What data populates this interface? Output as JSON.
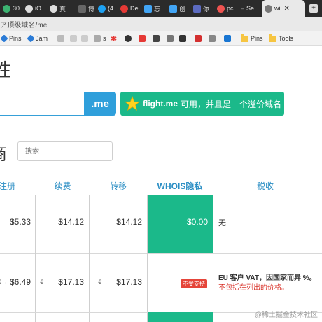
{
  "tabs": [
    {
      "label": "30",
      "icon": "green-circle-icon",
      "color": "#3cb371"
    },
    {
      "label": "iO",
      "icon": "link-icon",
      "color": "#e0e0e0"
    },
    {
      "label": "真",
      "icon": "link-icon",
      "color": "#e0e0e0"
    },
    {
      "label": "博",
      "icon": "doc-icon",
      "color": "#555"
    },
    {
      "label": "(4",
      "icon": "twitter-icon",
      "color": "#1da1f2"
    },
    {
      "label": "De",
      "icon": "star-red-icon",
      "color": "#e53935"
    },
    {
      "label": "忘",
      "icon": "calendar-icon",
      "color": "#42a5f5"
    },
    {
      "label": "创",
      "icon": "mail-icon",
      "color": "#42a5f5"
    },
    {
      "label": "你",
      "icon": "page-icon",
      "color": "#5c6bc0"
    },
    {
      "label": "pc",
      "icon": "pc-icon",
      "color": "#ef5350"
    },
    {
      "label": "Se",
      "icon": "dash-icon",
      "color": "#888"
    },
    {
      "label": "wi",
      "icon": "globe-icon",
      "color": "#e0e0e0"
    }
  ],
  "address": {
    "url": "ア顶级域名/me"
  },
  "bookmarks": [
    {
      "label": "Pins",
      "icon": "diamond-icon",
      "color": "#2b7bd6"
    },
    {
      "label": "Jam",
      "icon": "diamond-icon",
      "color": "#2b7bd6"
    },
    {
      "label": "s",
      "icon": "pinwheel-icon",
      "color": "#999"
    },
    {
      "label": "Pins",
      "icon": "folder-icon",
      "color": "#f6c542"
    },
    {
      "label": "Tools",
      "icon": "folder-icon",
      "color": "#f6c542"
    }
  ],
  "page": {
    "heading_domain": "性",
    "domain_input_value": "",
    "suffix": ".me",
    "avail_domain": "flight.me",
    "avail_text": " 可用，并且是一个溢价域名",
    "heading_price": "商",
    "search_placeholder": "搜索"
  },
  "table": {
    "headers": [
      "注册",
      "续费",
      "转移",
      "WHOIS隐私",
      "税收"
    ],
    "rows": [
      {
        "register": "$5.33",
        "renew": "$14.12",
        "transfer": "$14.12",
        "whois": "$0.00",
        "tax": "无"
      },
      {
        "register_cur": "€→",
        "register": "$6.49",
        "renew_cur": "€→",
        "renew": "$17.13",
        "transfer_cur": "€→",
        "transfer": "$17.13",
        "whois_badge": "不受支持",
        "tax_line1": "EU 客户 VAT，因国家而异 %。",
        "tax_line2": "不包括在列出的价格。"
      }
    ]
  },
  "watermark": "@稀土掘金技术社区",
  "colors": {
    "accent": "#2f9fdb",
    "green": "#1bb98a",
    "header_text": "#2a8ec4",
    "badge": "#e5453a"
  }
}
